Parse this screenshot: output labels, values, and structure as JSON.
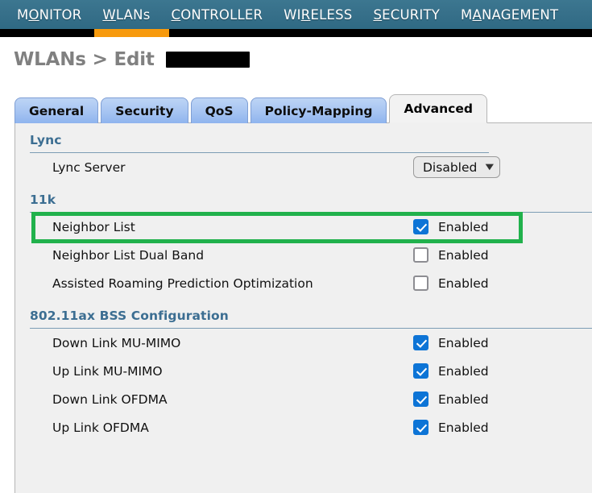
{
  "topnav": {
    "items": [
      {
        "label": "MONITOR",
        "accesskey_index": 1,
        "active": false
      },
      {
        "label": "WLANs",
        "accesskey_index": 0,
        "active": true
      },
      {
        "label": "CONTROLLER",
        "accesskey_index": 0,
        "active": false
      },
      {
        "label": "WIRELESS",
        "accesskey_index": 2,
        "active": false
      },
      {
        "label": "SECURITY",
        "accesskey_index": 0,
        "active": false
      },
      {
        "label": "MANAGEMENT",
        "accesskey_index": 1,
        "active": false
      }
    ],
    "active_indicator_color": "#f79a0d",
    "background_color": "#37708a"
  },
  "page": {
    "title": "WLANs > Edit",
    "redacted_value": ""
  },
  "tabs": [
    {
      "label": "General",
      "active": false
    },
    {
      "label": "Security",
      "active": false
    },
    {
      "label": "QoS",
      "active": false
    },
    {
      "label": "Policy-Mapping",
      "active": false
    },
    {
      "label": "Advanced",
      "active": true
    }
  ],
  "sections": [
    {
      "title": "Lync",
      "rule_width": "short",
      "rows": [
        {
          "label": "Lync Server",
          "control": "select",
          "value": "Disabled",
          "highlighted": false
        }
      ]
    },
    {
      "title": "11k",
      "rule_width": "full",
      "rows": [
        {
          "label": "Neighbor List",
          "control": "checkbox",
          "checked": true,
          "checkbox_label": "Enabled",
          "highlighted": true
        },
        {
          "label": "Neighbor List Dual Band",
          "control": "checkbox",
          "checked": false,
          "checkbox_label": "Enabled",
          "highlighted": false
        },
        {
          "label": "Assisted Roaming Prediction Optimization",
          "control": "checkbox",
          "checked": false,
          "checkbox_label": "Enabled",
          "highlighted": false
        }
      ]
    },
    {
      "title": "802.11ax BSS Configuration",
      "rule_width": "full",
      "rows": [
        {
          "label": "Down Link MU-MIMO",
          "control": "checkbox",
          "checked": true,
          "checkbox_label": "Enabled",
          "highlighted": false
        },
        {
          "label": "Up Link MU-MIMO",
          "control": "checkbox",
          "checked": true,
          "checkbox_label": "Enabled",
          "highlighted": false
        },
        {
          "label": "Down Link OFDMA",
          "control": "checkbox",
          "checked": true,
          "checkbox_label": "Enabled",
          "highlighted": false
        },
        {
          "label": "Up Link OFDMA",
          "control": "checkbox",
          "checked": true,
          "checkbox_label": "Enabled",
          "highlighted": false
        }
      ]
    }
  ],
  "icons": {
    "chevron_down": "⌄",
    "checkmark": "✓"
  },
  "colors": {
    "highlight_green": "#21b14c",
    "checkbox_blue": "#0d74d6",
    "section_title_blue": "#3c6e92",
    "nav_teal": "#37708a",
    "nav_orange": "#f79a0d"
  }
}
